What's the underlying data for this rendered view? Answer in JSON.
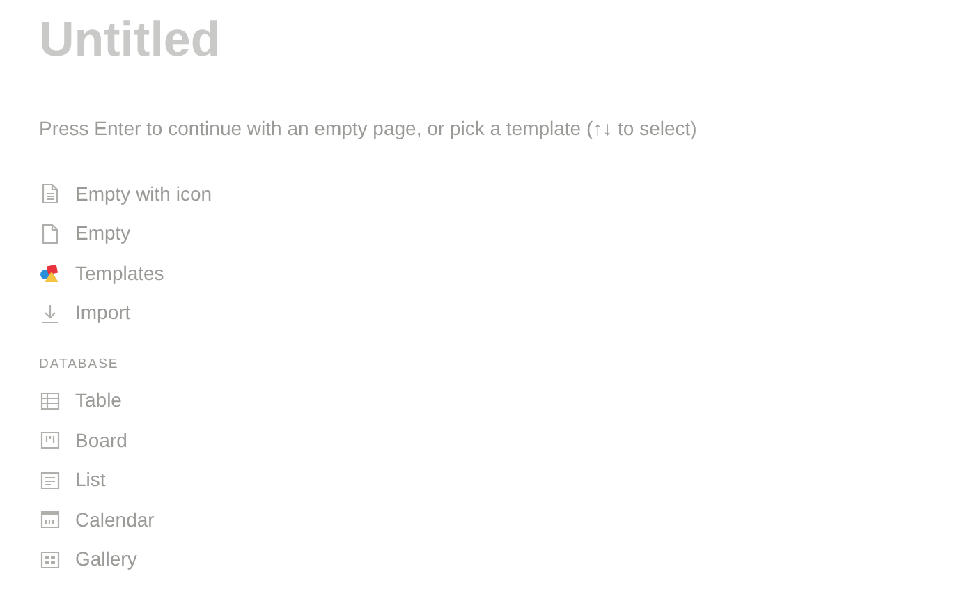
{
  "title": "Untitled",
  "hint": "Press Enter to continue with an empty page, or pick a template (↑↓ to select)",
  "options": [
    {
      "label": "Empty with icon",
      "kind": "doc-lines"
    },
    {
      "label": "Empty",
      "kind": "doc"
    },
    {
      "label": "Templates",
      "kind": "shapes"
    },
    {
      "label": "Import",
      "kind": "download"
    }
  ],
  "database": {
    "heading": "DATABASE",
    "items": [
      {
        "label": "Table",
        "kind": "table"
      },
      {
        "label": "Board",
        "kind": "board"
      },
      {
        "label": "List",
        "kind": "list"
      },
      {
        "label": "Calendar",
        "kind": "calendar"
      },
      {
        "label": "Gallery",
        "kind": "gallery"
      }
    ]
  }
}
